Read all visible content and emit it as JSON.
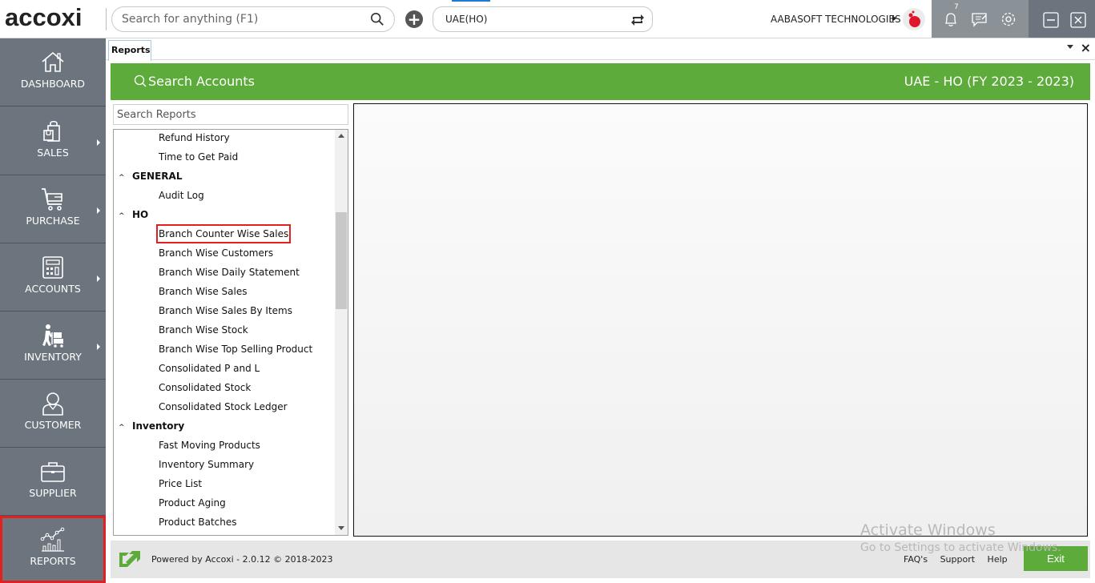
{
  "app": {
    "logo_text": "accoxi",
    "global_search_placeholder": "Search for anything (F1)",
    "branch_selector_value": "UAE(HO)",
    "company_name": "AABASOFT TECHNOLOGIES",
    "notification_count": "7"
  },
  "sidebar": {
    "items": [
      {
        "label": "DASHBOARD",
        "icon": "home-icon",
        "has_submenu": false,
        "active": false
      },
      {
        "label": "SALES",
        "icon": "shopping-bag-icon",
        "has_submenu": true,
        "active": false
      },
      {
        "label": "PURCHASE",
        "icon": "cart-icon",
        "has_submenu": true,
        "active": false
      },
      {
        "label": "ACCOUNTS",
        "icon": "calculator-icon",
        "has_submenu": true,
        "active": false
      },
      {
        "label": "INVENTORY",
        "icon": "hand-truck-icon",
        "has_submenu": true,
        "active": false
      },
      {
        "label": "CUSTOMER",
        "icon": "person-icon",
        "has_submenu": false,
        "active": false
      },
      {
        "label": "SUPPLIER",
        "icon": "briefcase-icon",
        "has_submenu": false,
        "active": false
      },
      {
        "label": "REPORTS",
        "icon": "chart-icon",
        "has_submenu": false,
        "active": true
      }
    ]
  },
  "tabs": {
    "active_tab": "Reports"
  },
  "header": {
    "search_accounts_label": "Search Accounts",
    "fiscal_label": "UAE - HO (FY 2023 - 2023)"
  },
  "reports": {
    "search_placeholder": "Search Reports",
    "tree": [
      {
        "type": "leaf",
        "label": "Refund History"
      },
      {
        "type": "leaf",
        "label": "Time to Get Paid"
      },
      {
        "type": "group",
        "label": "GENERAL"
      },
      {
        "type": "leaf",
        "label": "Audit Log"
      },
      {
        "type": "group",
        "label": "HO"
      },
      {
        "type": "leaf",
        "label": "Branch Counter Wise Sales",
        "selected": true
      },
      {
        "type": "leaf",
        "label": "Branch Wise Customers"
      },
      {
        "type": "leaf",
        "label": "Branch Wise Daily Statement"
      },
      {
        "type": "leaf",
        "label": "Branch Wise Sales"
      },
      {
        "type": "leaf",
        "label": "Branch Wise Sales By Items"
      },
      {
        "type": "leaf",
        "label": "Branch Wise Stock"
      },
      {
        "type": "leaf",
        "label": "Branch Wise Top Selling Product"
      },
      {
        "type": "leaf",
        "label": "Consolidated P and L"
      },
      {
        "type": "leaf",
        "label": "Consolidated Stock"
      },
      {
        "type": "leaf",
        "label": "Consolidated Stock Ledger"
      },
      {
        "type": "group",
        "label": "Inventory"
      },
      {
        "type": "leaf",
        "label": "Fast Moving Products"
      },
      {
        "type": "leaf",
        "label": "Inventory Summary"
      },
      {
        "type": "leaf",
        "label": "Price List"
      },
      {
        "type": "leaf",
        "label": "Product Aging"
      },
      {
        "type": "leaf",
        "label": "Product Batches"
      }
    ]
  },
  "footer": {
    "powered_by": "Powered by Accoxi - 2.0.12 © 2018-2023",
    "links": [
      "FAQ's",
      "Support",
      "Help"
    ],
    "exit_label": "Exit"
  },
  "watermark": {
    "line1": "Activate Windows",
    "line2": "Go to Settings to activate Windows."
  },
  "colors": {
    "brand_green": "#5dab3a",
    "sidebar_bg": "#6c757d",
    "highlight_red": "#e32020"
  }
}
